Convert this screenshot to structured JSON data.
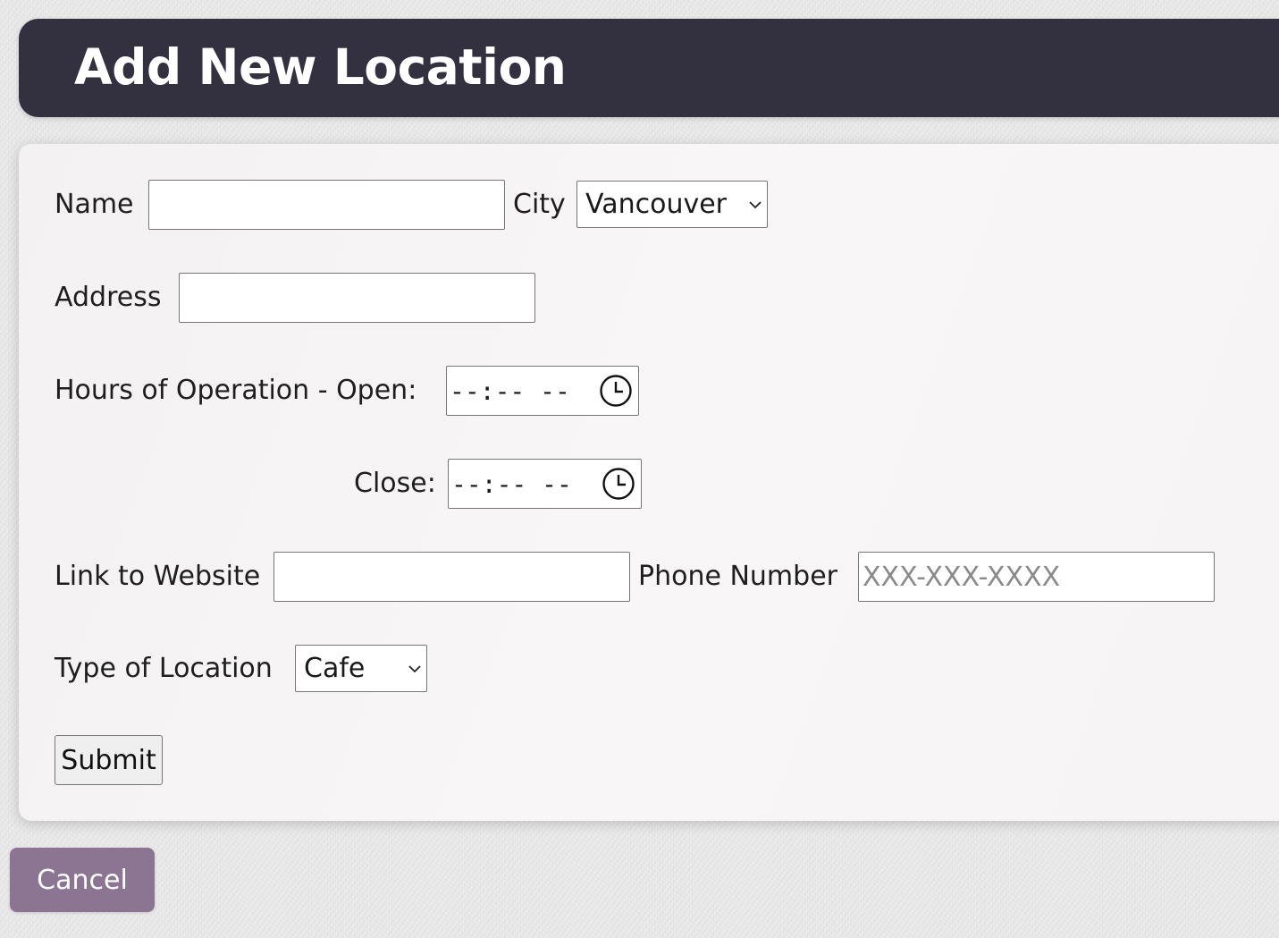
{
  "header": {
    "title": "Add New Location"
  },
  "form": {
    "name": {
      "label": "Name",
      "value": "",
      "placeholder": ""
    },
    "city": {
      "label": "City",
      "selected": "Vancouver"
    },
    "address": {
      "label": "Address",
      "value": "",
      "placeholder": ""
    },
    "hours": {
      "open_label": "Hours of Operation - Open:",
      "open_value": "--:-- --",
      "close_label": "Close:",
      "close_value": "--:-- --"
    },
    "website": {
      "label": "Link to Website",
      "value": "",
      "placeholder": ""
    },
    "phone": {
      "label": "Phone Number",
      "value": "",
      "placeholder": "XXX-XXX-XXXX"
    },
    "location_type": {
      "label": "Type of Location",
      "selected": "Cafe"
    },
    "submit_label": "Submit"
  },
  "cancel_label": "Cancel",
  "colors": {
    "header_bg": "#33303f",
    "cancel_bg": "#8b7593",
    "card_bg": "#f6f4f4"
  },
  "icons": {
    "select_arrow": "chevron-down-icon",
    "time_picker": "clock-icon"
  }
}
